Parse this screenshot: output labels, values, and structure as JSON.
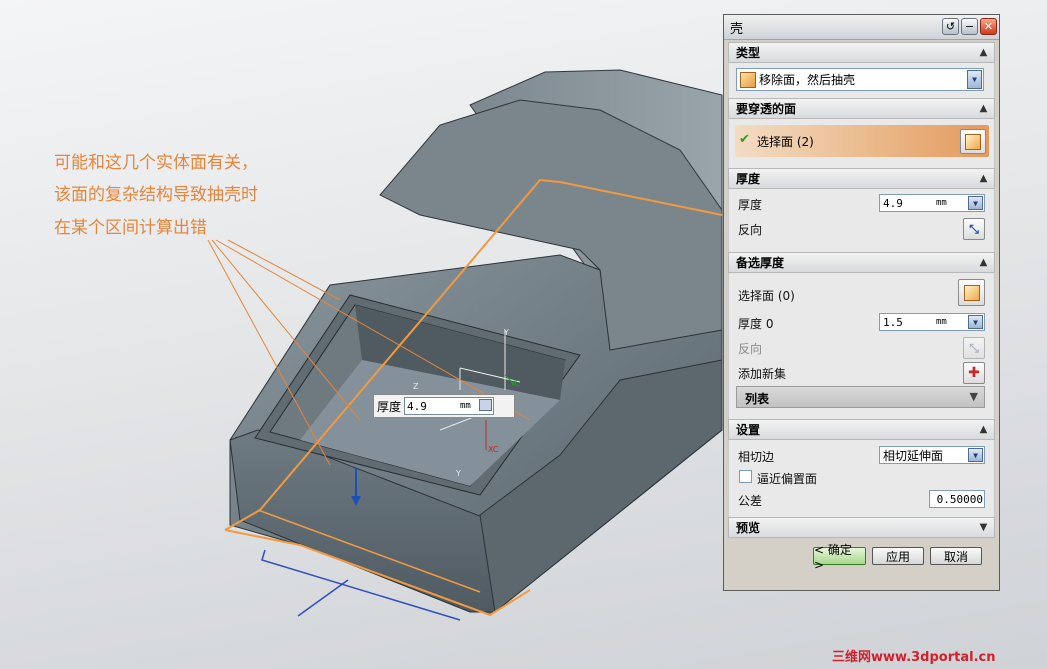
{
  "annotation": {
    "lines": [
      "可能和这几个实体面有关，",
      "该面的复杂结构导致抽壳时",
      "在某个区间计算出错"
    ]
  },
  "viewport": {
    "popup": {
      "label": "厚度",
      "value": "4.9",
      "unit": "mm"
    },
    "axes": {
      "y": "Y",
      "z": "Z",
      "xc": "XC",
      "yc": "YC",
      "y2": "Y"
    }
  },
  "dialog": {
    "title": "壳",
    "sections": {
      "type": {
        "header": "类型",
        "select_value": "移除面，然后抽壳"
      },
      "pierce": {
        "header": "要穿透的面",
        "select_label": "选择面 (2)"
      },
      "thickness": {
        "header": "厚度",
        "thickness_label": "厚度",
        "thickness_value": "4.9",
        "unit": "mm",
        "reverse_label": "反向"
      },
      "alt_thickness": {
        "header": "备选厚度",
        "select_label": "选择面 (0)",
        "thickness_label": "厚度 0",
        "thickness_value": "1.5",
        "unit": "mm",
        "reverse_label": "反向",
        "add_set_label": "添加新集",
        "list_label": "列表"
      },
      "settings": {
        "header": "设置",
        "tangent_label": "相切边",
        "tangent_value": "相切延伸面",
        "approx_label": "逼近偏置面",
        "tolerance_label": "公差",
        "tolerance_value": "0.50000"
      },
      "preview": {
        "header": "预览"
      }
    },
    "buttons": {
      "ok": "< 确定 >",
      "apply": "应用",
      "cancel": "取消"
    }
  },
  "watermark": "三维网www.3dportal.cn",
  "colors": {
    "accent_orange": "#e8853a",
    "model_gray": "#707b82",
    "watermark_red": "#d51f2a"
  }
}
